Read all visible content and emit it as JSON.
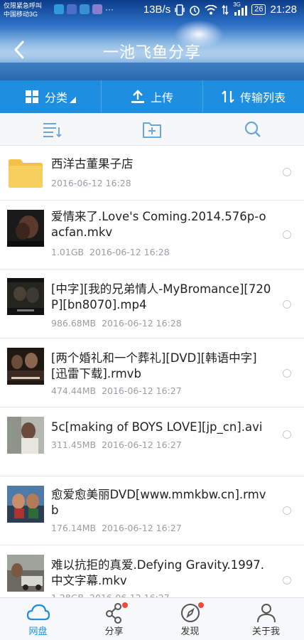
{
  "status": {
    "carrier_line1": "仅限紧急呼叫",
    "carrier_line2": "中国移动3G",
    "speed": "13B/s",
    "network": "3G",
    "battery": "26",
    "time": "21:28"
  },
  "header": {
    "title": "一池飞鱼分享"
  },
  "tabs": [
    {
      "label": "分类"
    },
    {
      "label": "上传"
    },
    {
      "label": "传输列表"
    }
  ],
  "files": [
    {
      "name": "西洋古董果子店",
      "size": "",
      "date": "2016-06-12  16:28",
      "type": "folder"
    },
    {
      "name": "爱情来了.Love's Coming.2014.576p-oacfan.mkv",
      "size": "1.01GB",
      "date": "2016-06-12  16:28",
      "type": "video"
    },
    {
      "name": "[中字][我的兄弟情人-MyBromance][720P][bn8070].mp4",
      "size": "986.68MB",
      "date": "2016-06-12  16:28",
      "type": "video"
    },
    {
      "name": "[两个婚礼和一个葬礼][DVD][韩语中字][迅雷下载].rmvb",
      "size": "474.44MB",
      "date": "2016-06-12  16:27",
      "type": "video"
    },
    {
      "name": "5c[making of BOYS LOVE][jp_cn].avi",
      "size": "311.45MB",
      "date": "2016-06-12  16:27",
      "type": "video"
    },
    {
      "name": "愈爱愈美丽DVD[www.mmkbw.cn].rmvb",
      "size": "176.14MB",
      "date": "2016-06-12  16:27",
      "type": "video"
    },
    {
      "name": "难以抗拒的真爱.Defying Gravity.1997.中文字幕.mkv",
      "size": "1.28GB",
      "date": "2016-06-12  16:27",
      "type": "video"
    }
  ],
  "bottom_nav": [
    {
      "label": "网盘",
      "active": true
    },
    {
      "label": "分享",
      "active": false
    },
    {
      "label": "发现",
      "active": false
    },
    {
      "label": "关于我",
      "active": false
    }
  ],
  "colors": {
    "accent": "#1e8ee0",
    "badge": "#f04a3a"
  }
}
